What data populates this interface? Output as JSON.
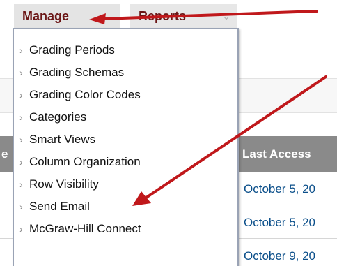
{
  "menubar": {
    "manage_label": "Manage",
    "reports_label": "Reports",
    "reports_chevron": "⌄"
  },
  "dropdown": {
    "items": [
      {
        "label": "Grading Periods"
      },
      {
        "label": "Grading Schemas"
      },
      {
        "label": "Grading Color Codes"
      },
      {
        "label": "Categories"
      },
      {
        "label": "Smart Views"
      },
      {
        "label": "Column Organization"
      },
      {
        "label": "Row Visibility"
      },
      {
        "label": "Send Email"
      },
      {
        "label": "McGraw-Hill Connect"
      }
    ],
    "bullet": "›"
  },
  "table": {
    "header_partial": "e",
    "last_access_header": "Last Access",
    "rows": [
      {
        "last_access": "October 5, 20"
      },
      {
        "last_access": "October 5, 20"
      },
      {
        "last_access": "October 9, 20"
      }
    ]
  },
  "colors": {
    "menu_text": "#6b1616",
    "annotation_arrow": "#c0181b",
    "date_link": "#0b4f8a",
    "table_header_bg": "#8a8a8a"
  }
}
